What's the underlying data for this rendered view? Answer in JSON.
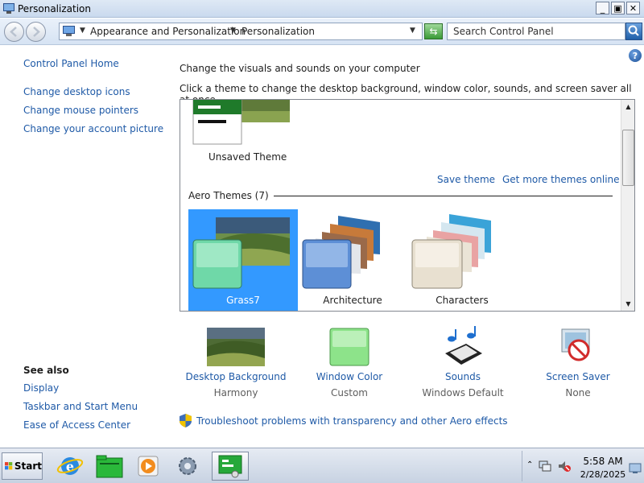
{
  "window": {
    "title": "Personalization",
    "minimize_glyph": "_",
    "maximize_glyph": "▣",
    "close_glyph": "✕"
  },
  "addressbar": {
    "crumbs": [
      "Appearance and Personalization",
      "Personalization"
    ],
    "search_placeholder": "Search Control Panel"
  },
  "sidebar": {
    "home": "Control Panel Home",
    "links": [
      "Change desktop icons",
      "Change mouse pointers",
      "Change your account picture"
    ],
    "see_also_title": "See also",
    "see_also": [
      "Display",
      "Taskbar and Start Menu",
      "Ease of Access Center"
    ]
  },
  "main": {
    "heading": "Change the visuals and sounds on your computer",
    "subheading": "Click a theme to change the desktop background, window color, sounds, and screen saver all at once.",
    "unsaved_theme": "Unsaved Theme",
    "save_theme": "Save theme",
    "more_themes": "Get more themes online",
    "aero_header": "Aero Themes (7)",
    "themes": [
      {
        "name": "Grass7",
        "selected": true
      },
      {
        "name": "Architecture",
        "selected": false
      },
      {
        "name": "Characters",
        "selected": false
      }
    ],
    "options": [
      {
        "label": "Desktop Background",
        "value": "Harmony"
      },
      {
        "label": "Window Color",
        "value": "Custom"
      },
      {
        "label": "Sounds",
        "value": "Windows Default"
      },
      {
        "label": "Screen Saver",
        "value": "None"
      }
    ],
    "troubleshoot": "Troubleshoot problems with transparency and other Aero effects",
    "help_glyph": "?"
  },
  "taskbar": {
    "start_label": "Start",
    "time": "5:58 AM",
    "date": "2/28/2025"
  },
  "colors": {
    "link": "#1f5aa7",
    "selection": "#3399ff"
  }
}
